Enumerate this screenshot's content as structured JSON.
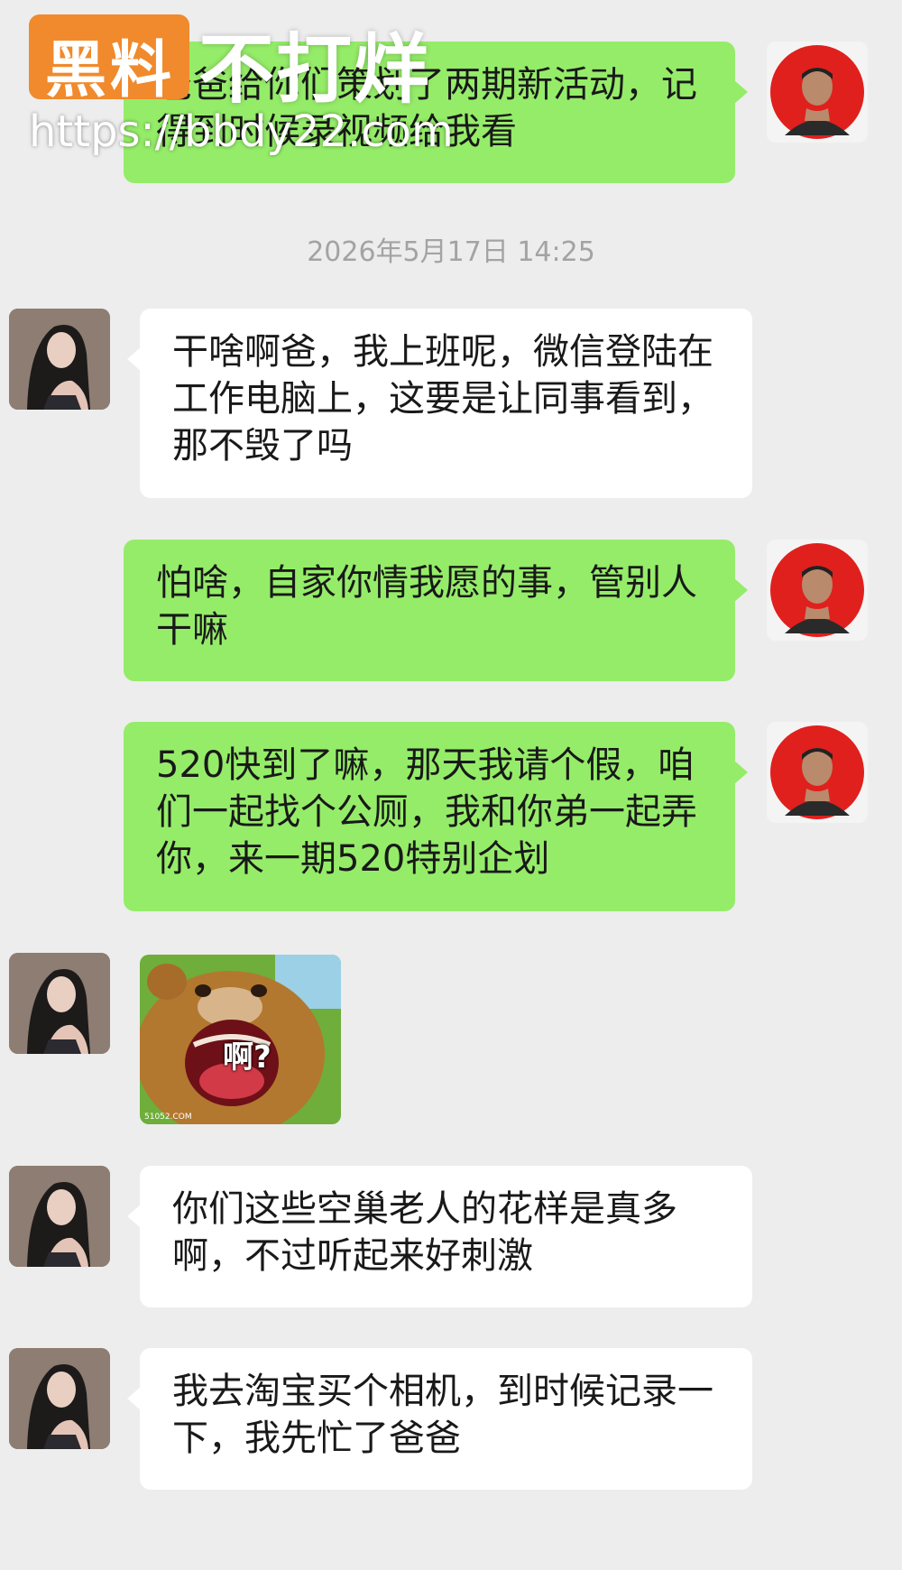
{
  "watermark": {
    "logo_text": "黑料",
    "title": "不打烊",
    "url": "https://bbdy22.com",
    "logo_color": "#f08a2c"
  },
  "timestamp": "2026年5月17日 14:25",
  "messages": [
    {
      "sender": "dad",
      "side": "right",
      "text": "爸爸给你们策划了两期新活动，记得到时候录视频给我看"
    },
    {
      "sender": "daughter",
      "side": "left",
      "text": "干啥啊爸，我上班呢，微信登陆在工作电脑上，这要是让同事看到，那不毁了吗"
    },
    {
      "sender": "dad",
      "side": "right",
      "text": "怕啥，自家你情我愿的事，管别人干嘛"
    },
    {
      "sender": "dad",
      "side": "right",
      "text": "520快到了嘛，那天我请个假，咱们一起找个公厕，我和你弟一起弄你，来一期520特别企划"
    },
    {
      "sender": "daughter",
      "side": "left",
      "type": "sticker",
      "sticker_text": "啊?",
      "sticker_mark": "51052.COM",
      "icon": "bear-surprised-sticker"
    },
    {
      "sender": "daughter",
      "side": "left",
      "text": "你们这些空巢老人的花样是真多啊，不过听起来好刺激"
    },
    {
      "sender": "daughter",
      "side": "left",
      "text": "我去淘宝买个相机，到时候记录一下，我先忙了爸爸"
    }
  ],
  "colors": {
    "background": "#ededed",
    "bubble_me": "#95ec69",
    "bubble_them": "#ffffff",
    "timestamp": "#a3a3a3",
    "dad_avatar_bg": "#e0201d"
  }
}
